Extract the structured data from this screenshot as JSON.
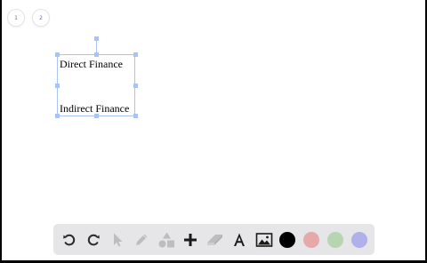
{
  "pages": [
    {
      "label": "1"
    },
    {
      "label": "2"
    }
  ],
  "textbox": {
    "line1": "Direct Finance",
    "line2": "Indirect Finance"
  },
  "toolbar": {
    "tools": [
      "undo-icon",
      "redo-icon",
      "select-pointer-icon",
      "pen-icon",
      "shapes-icon",
      "add-icon",
      "eraser-icon",
      "text-icon",
      "image-icon"
    ],
    "colors": [
      "#000000",
      "#e6a8a8",
      "#b7d5b1",
      "#b0b0ea"
    ]
  }
}
